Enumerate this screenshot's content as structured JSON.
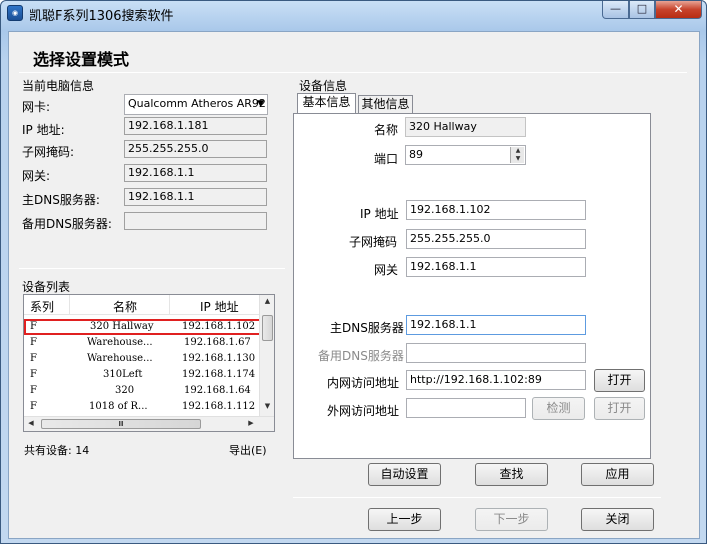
{
  "window": {
    "title": "凯聪F系列1306搜索软件",
    "min": "—",
    "max": "□",
    "close": "✕"
  },
  "heading": "选择设置模式",
  "pc_info": {
    "title": "当前电脑信息",
    "nic_label": "网卡:",
    "nic_value": "Qualcomm Atheros AR92",
    "ip_label": "IP 地址:",
    "ip_value": "192.168.1.181",
    "mask_label": "子网掩码:",
    "mask_value": "255.255.255.0",
    "gateway_label": "网关:",
    "gateway_value": "192.168.1.1",
    "dns1_label": "主DNS服务器:",
    "dns1_value": "192.168.1.1",
    "dns2_label": "备用DNS服务器:",
    "dns2_value": ""
  },
  "device_list": {
    "title": "设备列表",
    "columns": [
      "系列",
      "名称",
      "IP 地址"
    ],
    "rows": [
      {
        "series": "F",
        "name": "320 Hallway",
        "ip": "192.168.1.102"
      },
      {
        "series": "F",
        "name": "Warehouse...",
        "ip": "192.168.1.67"
      },
      {
        "series": "F",
        "name": "Warehouse...",
        "ip": "192.168.1.130"
      },
      {
        "series": "F",
        "name": "310Left",
        "ip": "192.168.1.174"
      },
      {
        "series": "F",
        "name": "320",
        "ip": "192.168.1.64"
      },
      {
        "series": "F",
        "name": "1018 of R...",
        "ip": "192.168.1.112"
      }
    ],
    "selected_index": 0,
    "total": "共有设备: 14",
    "export": "导出(E)",
    "scroll_thumb": "Ⅲ"
  },
  "device_info": {
    "title": "设备信息",
    "tabs": [
      "基本信息",
      "其他信息"
    ],
    "name_label": "名称",
    "name_value": "320 Hallway",
    "port_label": "端口",
    "port_value": "89",
    "ip_label": "IP 地址",
    "ip_value": "192.168.1.102",
    "mask_label": "子网掩码",
    "mask_value": "255.255.255.0",
    "gateway_label": "网关",
    "gateway_value": "192.168.1.1",
    "dns1_label": "主DNS服务器",
    "dns1_value": "192.168.1.1",
    "dns2_label": "备用DNS服务器",
    "dns2_value": "",
    "lan_label": "内网访问地址",
    "lan_value": "http://192.168.1.102:89",
    "wan_label": "外网访问地址",
    "wan_value": "",
    "open_label": "打开",
    "detect_label": "检测",
    "open2_label": "打开"
  },
  "buttons": {
    "auto": "自动设置",
    "find": "查找",
    "apply": "应用",
    "prev": "上一步",
    "next": "下一步",
    "close": "关闭"
  },
  "colors": {
    "selection_outline": "#e02020",
    "title_gradient_top": "#c9dff5"
  }
}
